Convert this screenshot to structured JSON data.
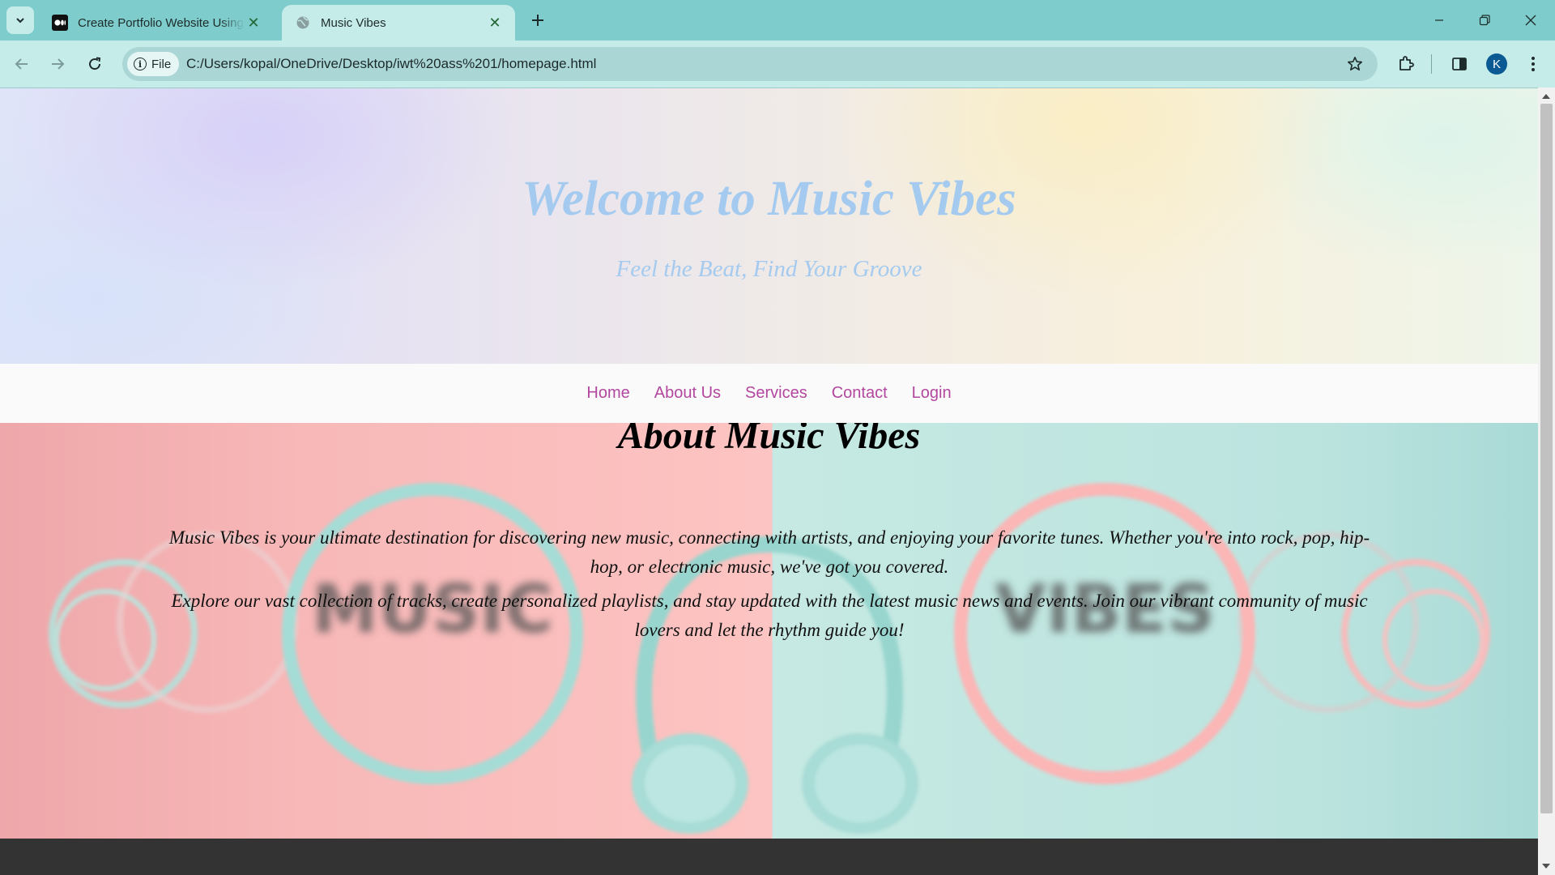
{
  "browser": {
    "tabs": [
      {
        "title": "Create Portfolio Website Using",
        "favicon": "medium-logo-icon",
        "active": false
      },
      {
        "title": "Music Vibes",
        "favicon": "globe-icon",
        "active": true
      }
    ],
    "address": {
      "chip_label": "File",
      "url": "C:/Users/kopal/OneDrive/Desktop/iwt%20ass%201/homepage.html"
    },
    "profile_initial": "K",
    "accent": "#7ecccb"
  },
  "page": {
    "hero": {
      "title": "Welcome to Music Vibes",
      "subtitle": "Feel the Beat, Find Your Groove",
      "text_color": "#a4cbef"
    },
    "nav": {
      "items": [
        "Home",
        "About Us",
        "Services",
        "Contact",
        "Login"
      ],
      "link_color": "#b3479f"
    },
    "about": {
      "title": "About Music Vibes",
      "paragraphs": [
        "Music Vibes is your ultimate destination for discovering new music, connecting with artists, and enjoying your favorite tunes. Whether you're into rock, pop, hip-hop, or electronic music, we've got you covered.",
        "Explore our vast collection of tracks, create personalized playlists, and stay updated with the latest music news and events. Join our vibrant community of music lovers and let the rhythm guide you!"
      ],
      "background_words": [
        "MUSIC",
        "VIBES"
      ],
      "colors": {
        "left": "#fcc4c2",
        "right": "#c6e9e3"
      }
    },
    "footer_color": "#333333"
  }
}
